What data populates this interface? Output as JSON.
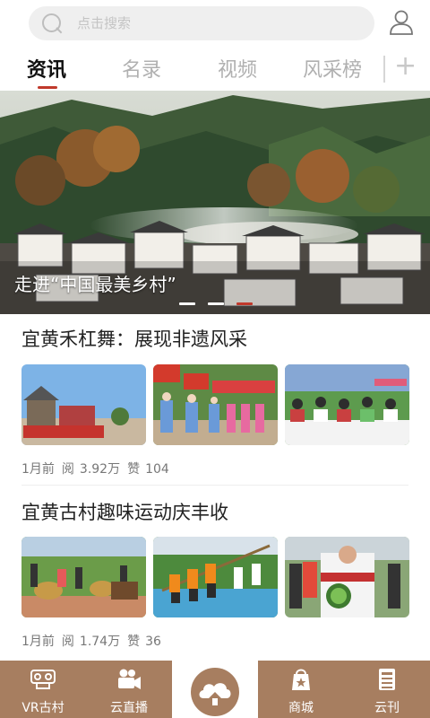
{
  "search": {
    "placeholder": "点击搜索"
  },
  "tabs": [
    {
      "label": "资讯",
      "active": true
    },
    {
      "label": "名录"
    },
    {
      "label": "视频"
    },
    {
      "label": "风采榜"
    }
  ],
  "tabs_add": "+",
  "banner": {
    "caption": "走进“中国最美乡村”",
    "pages": 3,
    "active_page": 3
  },
  "articles": [
    {
      "title": "宜黄禾杠舞：展现非遗风采",
      "time": "1月前",
      "reads_label": "阅",
      "reads": "3.92万",
      "likes_label": "赞",
      "likes": "104"
    },
    {
      "title": "宜黄古村趣味运动庆丰收",
      "time": "1月前",
      "reads_label": "阅",
      "reads": "1.74万",
      "likes_label": "赞",
      "likes": "36"
    }
  ],
  "bottom_nav": [
    {
      "label": "VR古村",
      "icon": "vr-glasses-icon"
    },
    {
      "label": "云直播",
      "icon": "video-camera-icon"
    },
    {
      "label": "商城",
      "icon": "shopping-bag-icon"
    },
    {
      "label": "云刊",
      "icon": "magazine-icon"
    }
  ],
  "colors": {
    "accent": "#c0392b",
    "nav_bg": "#a77e60"
  }
}
